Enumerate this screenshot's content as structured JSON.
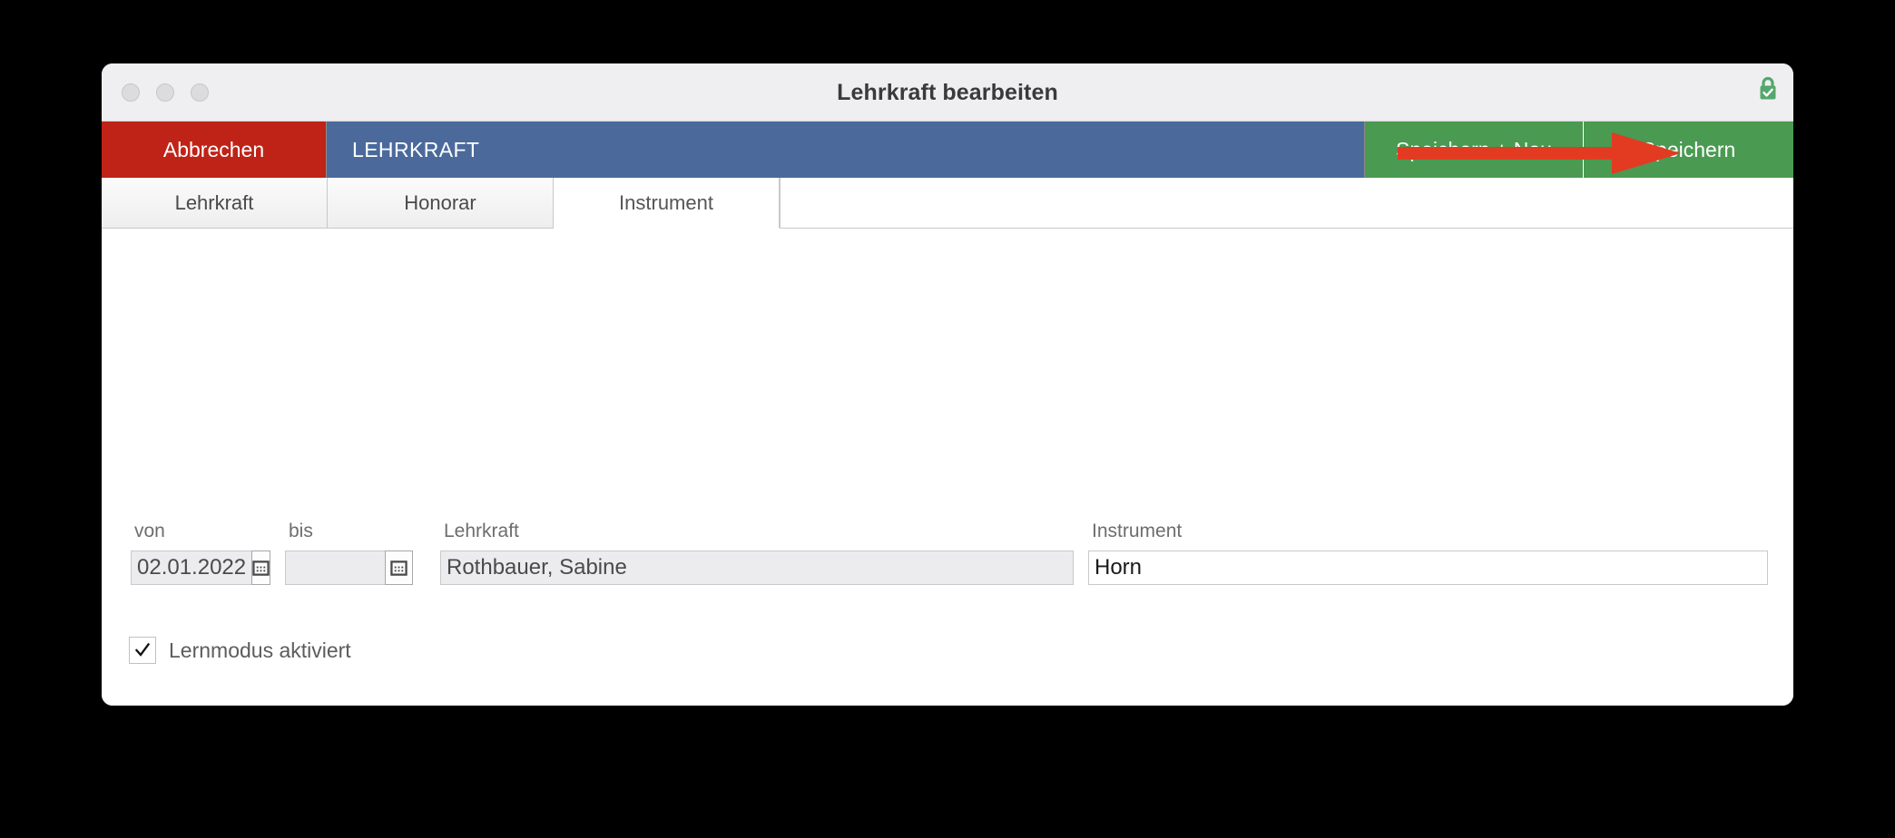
{
  "window": {
    "title": "Lehrkraft bearbeiten",
    "lock_icon": "green-lock-check-icon",
    "traffic_lights": [
      "close-button",
      "minimize-button",
      "zoom-button"
    ]
  },
  "actionbar": {
    "cancel_label": "Abbrechen",
    "section_title": "LEHRKRAFT",
    "save_new_label": "Speichern + Neu",
    "save_label": "Speichern",
    "colors": {
      "cancel": "#bf2317",
      "section": "#4b6a9b",
      "save": "#4a9a52"
    }
  },
  "tabs": [
    {
      "label": "Lehrkraft",
      "active": false
    },
    {
      "label": "Honorar",
      "active": false
    },
    {
      "label": "Instrument",
      "active": true
    }
  ],
  "form": {
    "fields": [
      {
        "label": "von",
        "value": "02.01.2022",
        "type": "date",
        "readonly": true,
        "icon": "calendar-icon"
      },
      {
        "label": "bis",
        "value": "",
        "type": "date",
        "readonly": true,
        "icon": "calendar-icon"
      },
      {
        "label": "Lehrkraft",
        "value": "Rothbauer, Sabine",
        "type": "text",
        "readonly": true
      },
      {
        "label": "Instrument",
        "value": "Horn",
        "type": "text",
        "readonly": false
      }
    ]
  },
  "checkbox": {
    "label": "Lernmodus aktiviert",
    "checked": true
  },
  "annotation": {
    "type": "arrow",
    "color": "#e23b22",
    "points_to": "Speichern"
  }
}
